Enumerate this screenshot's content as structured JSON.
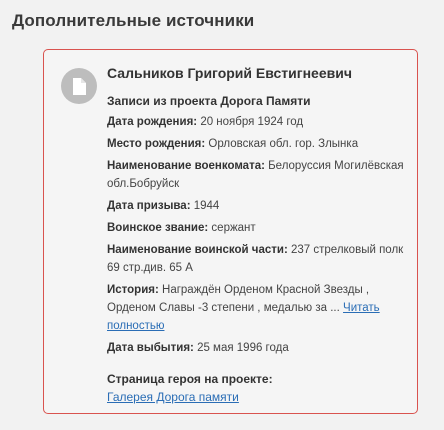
{
  "section": {
    "title": "Дополнительные источники"
  },
  "card": {
    "name": "Сальников Григорий Евстигнеевич",
    "project": "Записи из проекта Дорога Памяти",
    "fields": [
      {
        "label": "Дата рождения:",
        "value": " 20 ноября 1924 год"
      },
      {
        "label": "Место рождения:",
        "value": " Орловская обл. гор. Злынка"
      },
      {
        "label": "Наименование военкомата:",
        "value": " Белоруссия Могилёвская обл.Бобруйск"
      },
      {
        "label": "Дата призыва:",
        "value": " 1944"
      },
      {
        "label": "Воинское звание:",
        "value": " сержант"
      },
      {
        "label": "Наименование воинской части:",
        "value": " 237 стрелковый полк 69 стр.див. 65 А"
      },
      {
        "label": "История:",
        "value": " Награждён Орденом Красной Звезды , Орденом Славы -3 степени , медалью за ... ",
        "link": "Читать полностью"
      },
      {
        "label": "Дата выбытия:",
        "value": " 25 мая 1996 года"
      }
    ],
    "hero_label": "Страница героя на проекте:",
    "hero_link": "Галерея Дорога памяти"
  },
  "icons": {
    "document": "document-icon"
  },
  "colors": {
    "border": "#d9534f",
    "link": "#2a6db5",
    "icon_bg": "#bdbdbd"
  }
}
